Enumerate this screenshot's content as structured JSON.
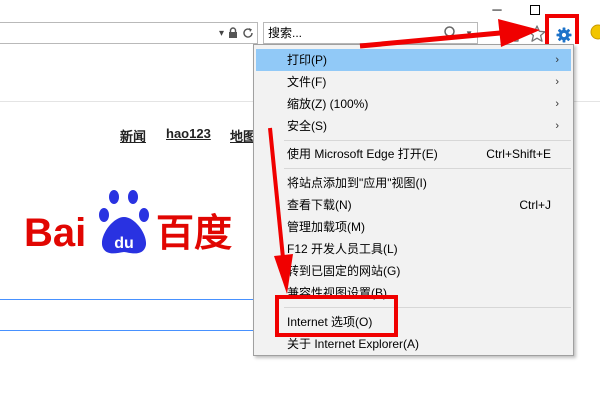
{
  "browser": {
    "search_placeholder": "搜索...",
    "icons": [
      "minimize-icon",
      "maximize-icon",
      "dropdown-arrow-icon",
      "lock-icon",
      "refresh-icon",
      "search-icon",
      "home-icon",
      "favorites-star-icon",
      "gear-icon",
      "smiley-icon"
    ]
  },
  "page": {
    "nav_links": [
      "新闻",
      "hao123",
      "地图"
    ],
    "logo": {
      "text_left": "Bai",
      "paw_text": "du",
      "text_right": "百度"
    }
  },
  "tools_menu": {
    "items": [
      {
        "label": "打印(P)",
        "has_submenu": true,
        "highlighted": true
      },
      {
        "label": "文件(F)",
        "has_submenu": true
      },
      {
        "label": "缩放(Z) (100%)",
        "has_submenu": true
      },
      {
        "label": "安全(S)",
        "has_submenu": true
      },
      {
        "label": "使用 Microsoft Edge 打开(E)",
        "shortcut": "Ctrl+Shift+E"
      },
      {
        "label": "将站点添加到\"应用\"视图(I)"
      },
      {
        "label": "查看下载(N)",
        "shortcut": "Ctrl+J"
      },
      {
        "label": "管理加载项(M)"
      },
      {
        "label": "F12 开发人员工具(L)"
      },
      {
        "label": "转到已固定的网站(G)"
      },
      {
        "label": "兼容性视图设置(B)"
      },
      {
        "label": "Internet 选项(O)",
        "annotated": true
      },
      {
        "label": "关于 Internet Explorer(A)"
      }
    ]
  },
  "annotations": {
    "color": "#f00000"
  },
  "colors": {
    "menu_highlight": "#91c9f7",
    "baidu_red": "#e10602",
    "baidu_blue": "#2932e1"
  }
}
